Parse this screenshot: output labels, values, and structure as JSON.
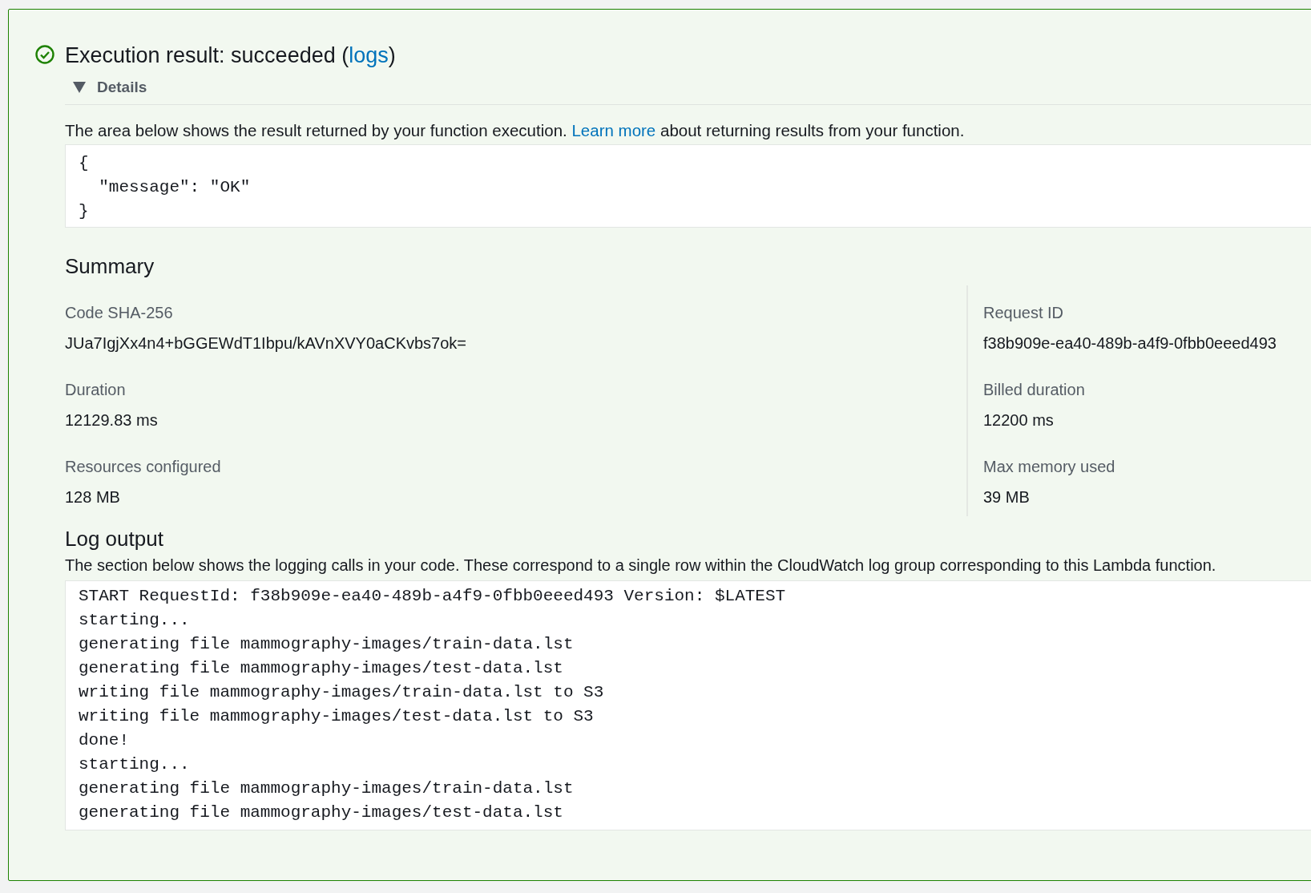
{
  "result": {
    "title": "Execution result: succeeded (",
    "link": "logs",
    "title_end": ")"
  },
  "details": {
    "label": "Details",
    "expanded": true
  },
  "result_description": {
    "text": "The area below shows the result returned by your function execution.",
    "link": "Learn more",
    "text_end": "about returning results from your function."
  },
  "result_code": [
    "{",
    "  \"message\": \"OK\"",
    "}"
  ],
  "summary": {
    "title": "Summary",
    "left": [
      {
        "label": "Code SHA-256",
        "value": "JUa7IgjXx4n4+bGGEWdT1Ibpu/kAVnXVY0aCKvbs7ok="
      },
      {
        "label": "Duration",
        "value": "12129.83 ms"
      },
      {
        "label": "Resources configured",
        "value": "128 MB"
      }
    ],
    "right": [
      {
        "label": "Request ID",
        "value": "f38b909e-ea40-489b-a4f9-0fbb0eeed493"
      },
      {
        "label": "Billed duration",
        "value": "12200 ms"
      },
      {
        "label": "Max memory used",
        "value": "39 MB"
      }
    ]
  },
  "log_output": {
    "title": "Log output",
    "description": "The section below shows the logging calls in your code. These correspond to a single row within the CloudWatch log group corresponding to this Lambda function.",
    "lines": [
      "START RequestId: f38b909e-ea40-489b-a4f9-0fbb0eeed493 Version: $LATEST",
      "starting...",
      "generating file mammography-images/train-data.lst",
      "generating file mammography-images/test-data.lst",
      "writing file mammography-images/train-data.lst to S3",
      "writing file mammography-images/test-data.lst to S3",
      "done!",
      "starting...",
      "generating file mammography-images/train-data.lst",
      "generating file mammography-images/test-data.lst"
    ]
  }
}
